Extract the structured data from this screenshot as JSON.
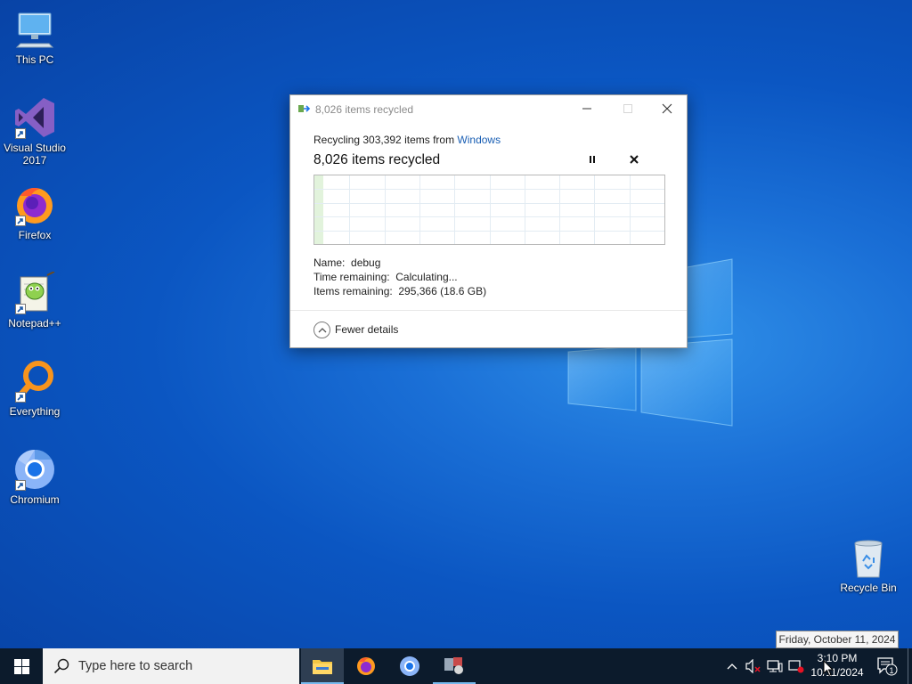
{
  "desktop": {
    "icons": [
      {
        "label": "This PC",
        "icon": "this-pc-icon"
      },
      {
        "label": "Visual Studio 2017",
        "icon": "visual-studio-icon"
      },
      {
        "label": "Firefox",
        "icon": "firefox-icon"
      },
      {
        "label": "Notepad++",
        "icon": "notepadpp-icon"
      },
      {
        "label": "Everything",
        "icon": "everything-icon"
      },
      {
        "label": "Chromium",
        "icon": "chromium-icon"
      },
      {
        "label": "Recycle Bin",
        "icon": "recycle-bin-icon"
      }
    ]
  },
  "dialog": {
    "title": "8,026 items recycled",
    "recycling_prefix": "Recycling 303,392 items from ",
    "recycling_source": "Windows",
    "status": "8,026 items recycled",
    "name_label": "Name:",
    "name_value": "debug",
    "time_label": "Time remaining:",
    "time_value": "Calculating...",
    "items_label": "Items remaining:",
    "items_value": "295,366 (18.6 GB)",
    "fewer_details": "Fewer details",
    "progress_fraction": 0.026
  },
  "tooltip": {
    "text": "Friday, October 11, 2024"
  },
  "taskbar": {
    "search_placeholder": "Type here to search",
    "apps": [
      "file-explorer-icon",
      "firefox-icon",
      "chromium-icon",
      "app-icon"
    ],
    "clock_time": "3:10 PM",
    "clock_date": "10/11/2024",
    "notification_count": "1"
  },
  "colors": {
    "accent": "#1a5fb4",
    "taskbar": "#0c1b2c",
    "desktop": "#0b56c2"
  }
}
